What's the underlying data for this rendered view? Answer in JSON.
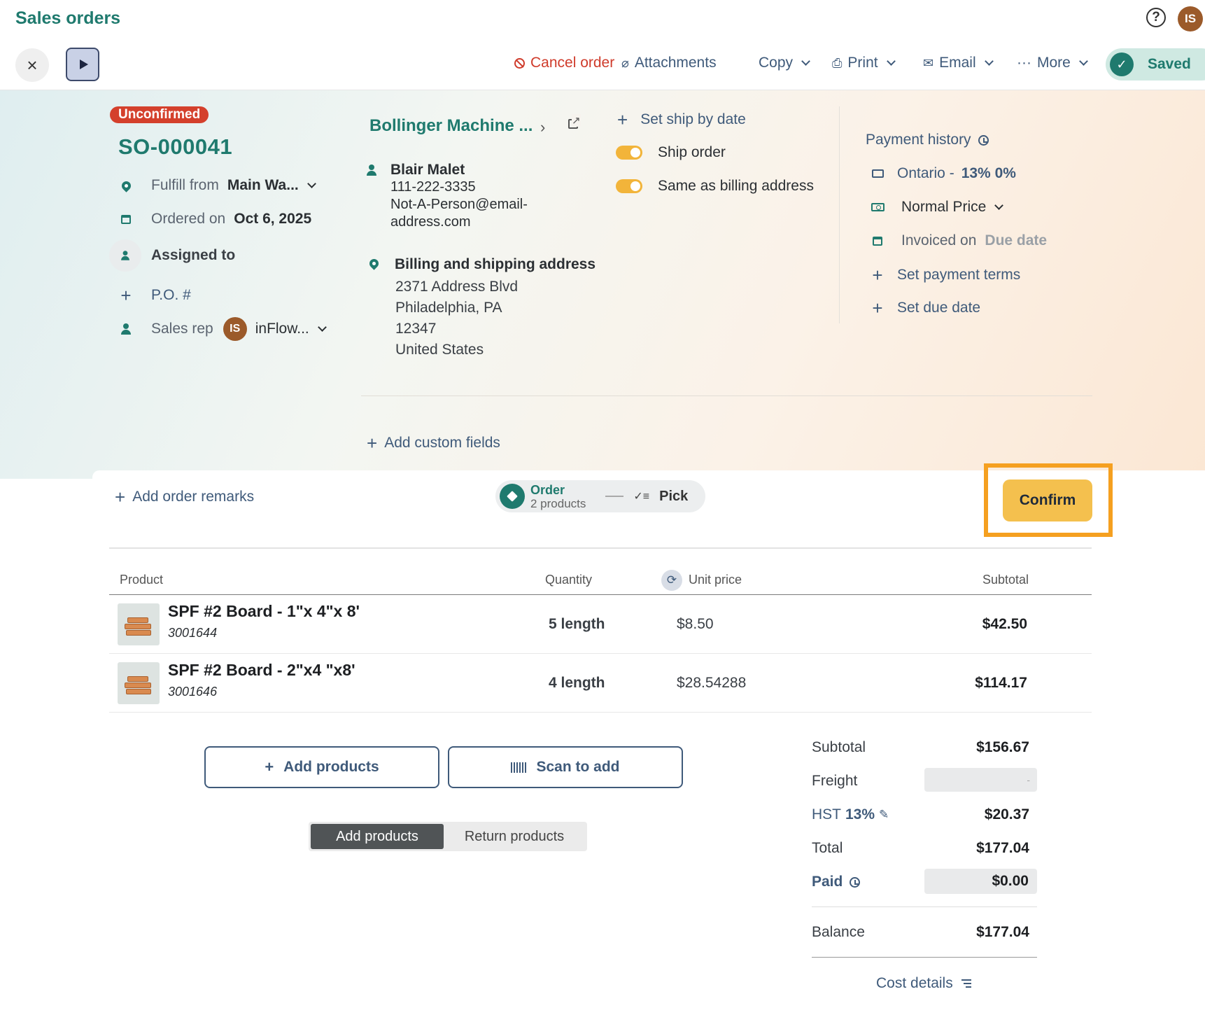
{
  "header": {
    "app_title": "Sales orders",
    "help_glyph": "?",
    "user_initials": "IS"
  },
  "toolbar": {
    "cancel_order": "Cancel order",
    "attachments": "Attachments",
    "copy": "Copy",
    "print": "Print",
    "email": "Email",
    "more": "More",
    "more_prefix": "···",
    "saved": "Saved"
  },
  "order": {
    "status": "Unconfirmed",
    "number": "SO-000041",
    "fulfill_label": "Fulfill from",
    "fulfill_value": "Main Wa...",
    "ordered_label": "Ordered on",
    "ordered_value": "Oct 6, 2025",
    "assigned_label": "Assigned to",
    "po_label": "P.O. #",
    "sales_rep_label": "Sales rep",
    "sales_rep_initials": "IS",
    "sales_rep_value": "inFlow..."
  },
  "customer": {
    "name": "Bollinger Machine ...",
    "contact_name": "Blair Malet",
    "phone": "111-222-3335",
    "email_line1": "Not-A-Person@email-",
    "email_line2": "address.com",
    "address_title": "Billing and shipping address",
    "address": [
      "2371 Address Blvd",
      "Philadelphia, PA",
      "12347",
      "United States"
    ]
  },
  "shipping": {
    "ship_by": "Set ship by date",
    "ship_order": "Ship order",
    "same_as_billing": "Same as billing address"
  },
  "payment": {
    "history": "Payment history",
    "tax_region": "Ontario -",
    "tax_rates": "13% 0%",
    "pricing": "Normal Price",
    "invoiced_label": "Invoiced on",
    "invoiced_value": "Due date",
    "payment_terms": "Set payment terms",
    "due_date": "Set due date"
  },
  "custom_fields": "Add custom fields",
  "order_remarks": "Add order remarks",
  "stage": {
    "order_label": "Order",
    "order_count": "2 products",
    "pick_label": "Pick"
  },
  "confirm_label": "Confirm",
  "table": {
    "headers": {
      "product": "Product",
      "quantity": "Quantity",
      "unit_price": "Unit price",
      "subtotal": "Subtotal"
    },
    "rows": [
      {
        "name": "SPF #2 Board - 1\"x 4\"x 8'",
        "sku": "3001644",
        "quantity": "5 length",
        "unit_price": "$8.50",
        "subtotal": "$42.50"
      },
      {
        "name": "SPF #2 Board - 2\"x4 \"x8'",
        "sku": "3001646",
        "quantity": "4 length",
        "unit_price": "$28.54288",
        "subtotal": "$114.17"
      }
    ]
  },
  "actions": {
    "add_products": "Add products",
    "scan_to_add": "Scan to add",
    "mode_add": "Add products",
    "mode_return": "Return products"
  },
  "summary": {
    "subtotal_label": "Subtotal",
    "subtotal_value": "$156.67",
    "freight_label": "Freight",
    "freight_value": "-",
    "hst_label": "HST",
    "hst_rate": "13%",
    "hst_value": "$20.37",
    "total_label": "Total",
    "total_value": "$177.04",
    "paid_label": "Paid",
    "paid_value": "$0.00",
    "balance_label": "Balance",
    "balance_value": "$177.04",
    "cost_details": "Cost details"
  },
  "colors": {
    "brand_teal": "#1f7a6e",
    "status_red": "#d4402c",
    "confirm_yellow": "#f4c04e",
    "highlight_orange": "#f5a020"
  }
}
